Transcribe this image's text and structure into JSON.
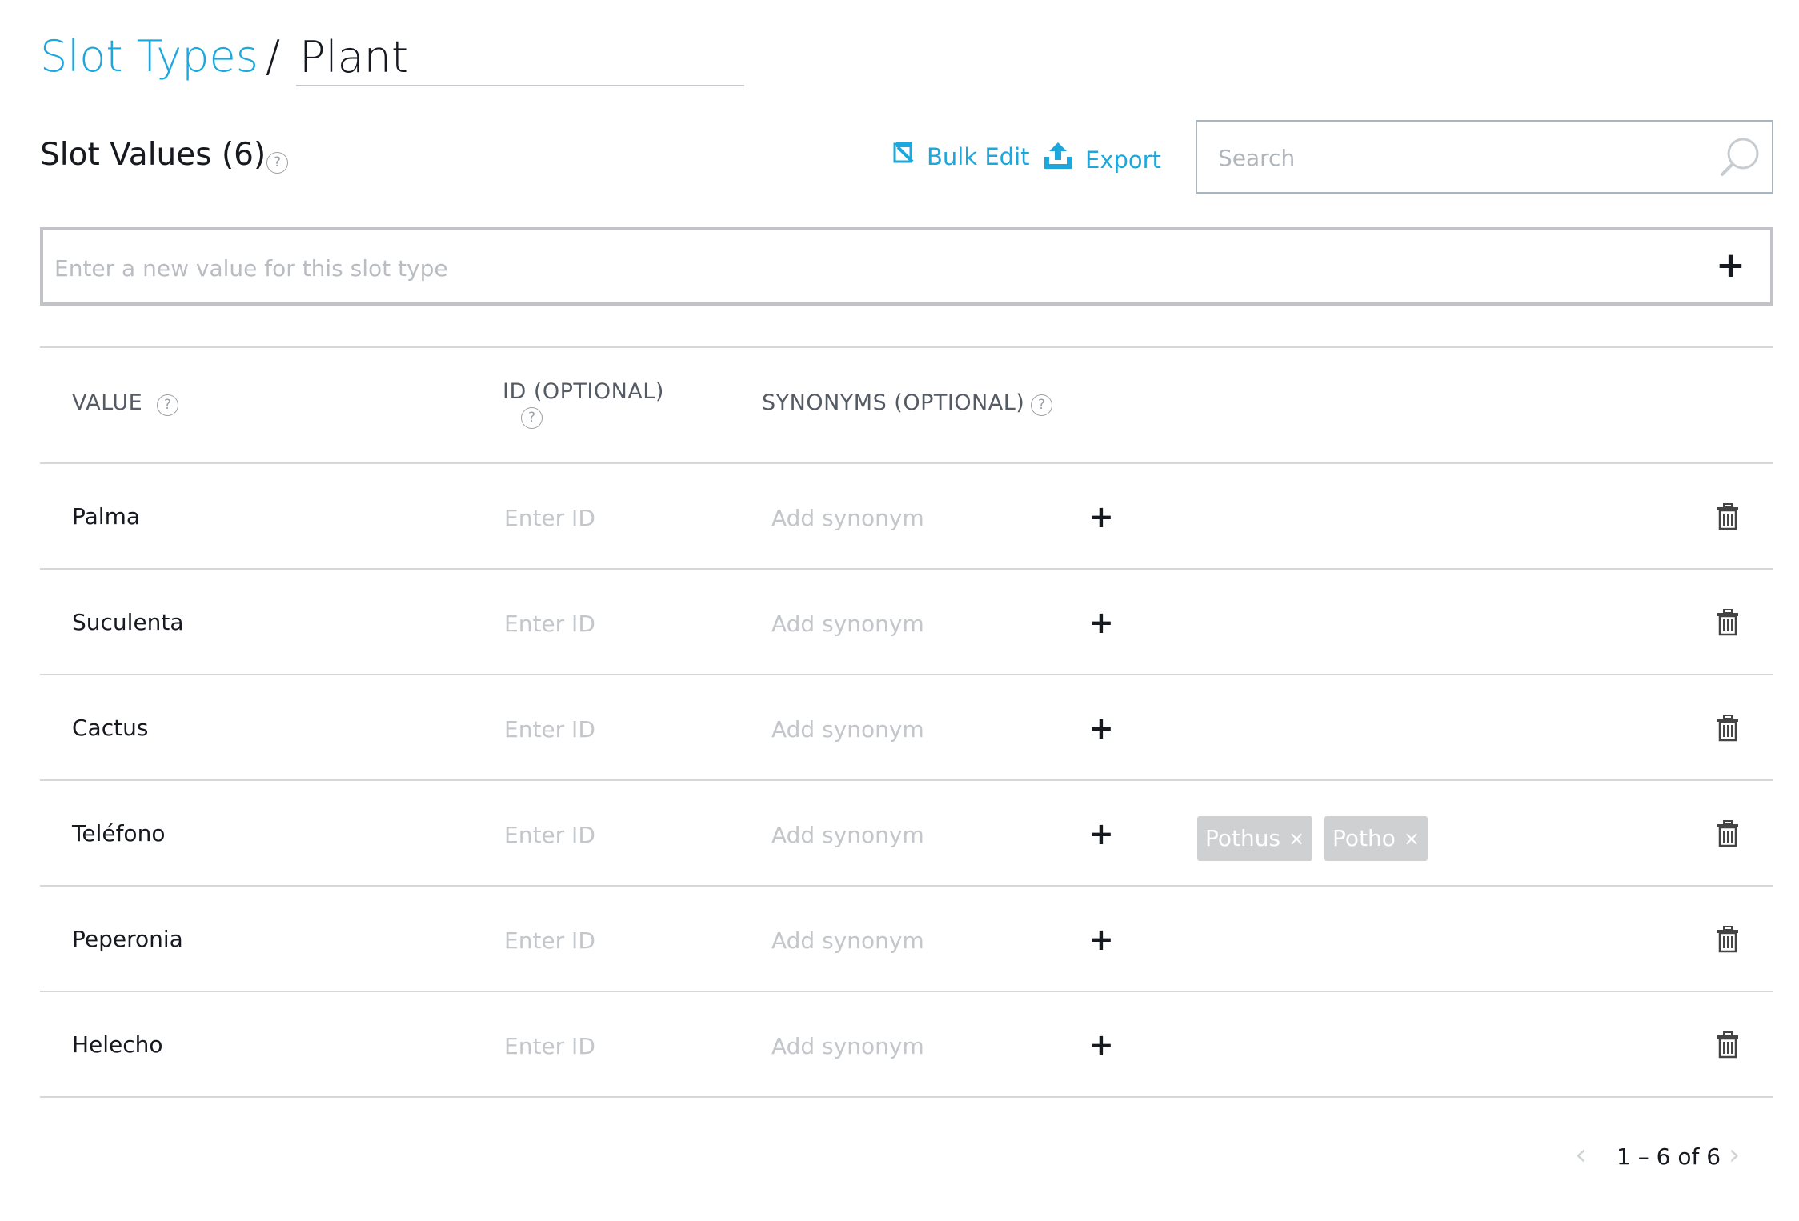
{
  "breadcrumb": {
    "parent": "Slot Types",
    "separator": "/",
    "current": "Plant"
  },
  "section": {
    "title": "Slot Values (6)",
    "help": "?"
  },
  "toolbar": {
    "bulk_edit": "Bulk Edit",
    "export": "Export"
  },
  "search": {
    "placeholder": "Search"
  },
  "new_value": {
    "placeholder": "Enter a new value for this slot type",
    "add": "+"
  },
  "columns": {
    "value": "VALUE",
    "id": "ID (OPTIONAL)",
    "synonyms": "SYNONYMS (OPTIONAL)",
    "help": "?"
  },
  "rows": [
    {
      "value": "Palma",
      "id_placeholder": "Enter ID",
      "synonym_placeholder": "Add synonym",
      "add": "+",
      "synonyms": []
    },
    {
      "value": "Suculenta",
      "id_placeholder": "Enter ID",
      "synonym_placeholder": "Add synonym",
      "add": "+",
      "synonyms": []
    },
    {
      "value": "Cactus",
      "id_placeholder": "Enter ID",
      "synonym_placeholder": "Add synonym",
      "add": "+",
      "synonyms": []
    },
    {
      "value": "Teléfono",
      "id_placeholder": "Enter ID",
      "synonym_placeholder": "Add synonym",
      "add": "+",
      "synonyms": [
        "Pothus",
        "Potho"
      ]
    },
    {
      "value": "Peperonia",
      "id_placeholder": "Enter ID",
      "synonym_placeholder": "Add synonym",
      "add": "+",
      "synonyms": []
    },
    {
      "value": "Helecho",
      "id_placeholder": "Enter ID",
      "synonym_placeholder": "Add synonym",
      "add": "+",
      "synonyms": []
    }
  ],
  "chip_remove": "×",
  "pagination": {
    "text": "1 – 6 of 6",
    "prev": "‹",
    "next": "›"
  },
  "colors": {
    "accent": "#1ca7dd",
    "chip": "#cfd0d2"
  }
}
